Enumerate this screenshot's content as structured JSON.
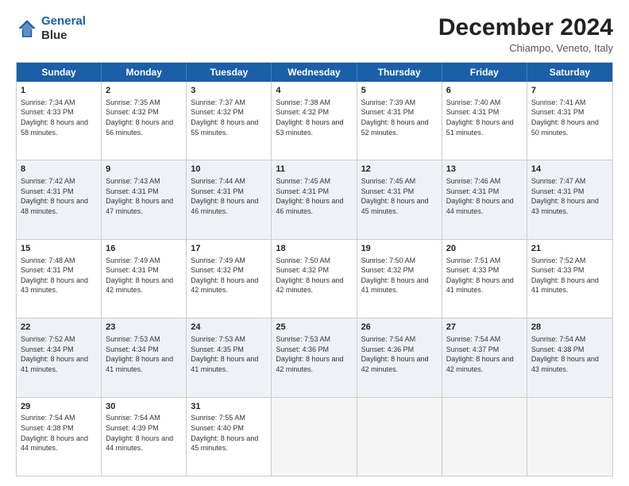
{
  "header": {
    "logo_line1": "General",
    "logo_line2": "Blue",
    "month_title": "December 2024",
    "location": "Chiampo, Veneto, Italy"
  },
  "weekdays": [
    "Sunday",
    "Monday",
    "Tuesday",
    "Wednesday",
    "Thursday",
    "Friday",
    "Saturday"
  ],
  "weeks": [
    [
      {
        "day": "1",
        "sunrise": "Sunrise: 7:34 AM",
        "sunset": "Sunset: 4:33 PM",
        "daylight": "Daylight: 8 hours and 58 minutes."
      },
      {
        "day": "2",
        "sunrise": "Sunrise: 7:35 AM",
        "sunset": "Sunset: 4:32 PM",
        "daylight": "Daylight: 8 hours and 56 minutes."
      },
      {
        "day": "3",
        "sunrise": "Sunrise: 7:37 AM",
        "sunset": "Sunset: 4:32 PM",
        "daylight": "Daylight: 8 hours and 55 minutes."
      },
      {
        "day": "4",
        "sunrise": "Sunrise: 7:38 AM",
        "sunset": "Sunset: 4:32 PM",
        "daylight": "Daylight: 8 hours and 53 minutes."
      },
      {
        "day": "5",
        "sunrise": "Sunrise: 7:39 AM",
        "sunset": "Sunset: 4:31 PM",
        "daylight": "Daylight: 8 hours and 52 minutes."
      },
      {
        "day": "6",
        "sunrise": "Sunrise: 7:40 AM",
        "sunset": "Sunset: 4:31 PM",
        "daylight": "Daylight: 8 hours and 51 minutes."
      },
      {
        "day": "7",
        "sunrise": "Sunrise: 7:41 AM",
        "sunset": "Sunset: 4:31 PM",
        "daylight": "Daylight: 8 hours and 50 minutes."
      }
    ],
    [
      {
        "day": "8",
        "sunrise": "Sunrise: 7:42 AM",
        "sunset": "Sunset: 4:31 PM",
        "daylight": "Daylight: 8 hours and 48 minutes."
      },
      {
        "day": "9",
        "sunrise": "Sunrise: 7:43 AM",
        "sunset": "Sunset: 4:31 PM",
        "daylight": "Daylight: 8 hours and 47 minutes."
      },
      {
        "day": "10",
        "sunrise": "Sunrise: 7:44 AM",
        "sunset": "Sunset: 4:31 PM",
        "daylight": "Daylight: 8 hours and 46 minutes."
      },
      {
        "day": "11",
        "sunrise": "Sunrise: 7:45 AM",
        "sunset": "Sunset: 4:31 PM",
        "daylight": "Daylight: 8 hours and 46 minutes."
      },
      {
        "day": "12",
        "sunrise": "Sunrise: 7:45 AM",
        "sunset": "Sunset: 4:31 PM",
        "daylight": "Daylight: 8 hours and 45 minutes."
      },
      {
        "day": "13",
        "sunrise": "Sunrise: 7:46 AM",
        "sunset": "Sunset: 4:31 PM",
        "daylight": "Daylight: 8 hours and 44 minutes."
      },
      {
        "day": "14",
        "sunrise": "Sunrise: 7:47 AM",
        "sunset": "Sunset: 4:31 PM",
        "daylight": "Daylight: 8 hours and 43 minutes."
      }
    ],
    [
      {
        "day": "15",
        "sunrise": "Sunrise: 7:48 AM",
        "sunset": "Sunset: 4:31 PM",
        "daylight": "Daylight: 8 hours and 43 minutes."
      },
      {
        "day": "16",
        "sunrise": "Sunrise: 7:49 AM",
        "sunset": "Sunset: 4:31 PM",
        "daylight": "Daylight: 8 hours and 42 minutes."
      },
      {
        "day": "17",
        "sunrise": "Sunrise: 7:49 AM",
        "sunset": "Sunset: 4:32 PM",
        "daylight": "Daylight: 8 hours and 42 minutes."
      },
      {
        "day": "18",
        "sunrise": "Sunrise: 7:50 AM",
        "sunset": "Sunset: 4:32 PM",
        "daylight": "Daylight: 8 hours and 42 minutes."
      },
      {
        "day": "19",
        "sunrise": "Sunrise: 7:50 AM",
        "sunset": "Sunset: 4:32 PM",
        "daylight": "Daylight: 8 hours and 41 minutes."
      },
      {
        "day": "20",
        "sunrise": "Sunrise: 7:51 AM",
        "sunset": "Sunset: 4:33 PM",
        "daylight": "Daylight: 8 hours and 41 minutes."
      },
      {
        "day": "21",
        "sunrise": "Sunrise: 7:52 AM",
        "sunset": "Sunset: 4:33 PM",
        "daylight": "Daylight: 8 hours and 41 minutes."
      }
    ],
    [
      {
        "day": "22",
        "sunrise": "Sunrise: 7:52 AM",
        "sunset": "Sunset: 4:34 PM",
        "daylight": "Daylight: 8 hours and 41 minutes."
      },
      {
        "day": "23",
        "sunrise": "Sunrise: 7:53 AM",
        "sunset": "Sunset: 4:34 PM",
        "daylight": "Daylight: 8 hours and 41 minutes."
      },
      {
        "day": "24",
        "sunrise": "Sunrise: 7:53 AM",
        "sunset": "Sunset: 4:35 PM",
        "daylight": "Daylight: 8 hours and 41 minutes."
      },
      {
        "day": "25",
        "sunrise": "Sunrise: 7:53 AM",
        "sunset": "Sunset: 4:36 PM",
        "daylight": "Daylight: 8 hours and 42 minutes."
      },
      {
        "day": "26",
        "sunrise": "Sunrise: 7:54 AM",
        "sunset": "Sunset: 4:36 PM",
        "daylight": "Daylight: 8 hours and 42 minutes."
      },
      {
        "day": "27",
        "sunrise": "Sunrise: 7:54 AM",
        "sunset": "Sunset: 4:37 PM",
        "daylight": "Daylight: 8 hours and 42 minutes."
      },
      {
        "day": "28",
        "sunrise": "Sunrise: 7:54 AM",
        "sunset": "Sunset: 4:38 PM",
        "daylight": "Daylight: 8 hours and 43 minutes."
      }
    ],
    [
      {
        "day": "29",
        "sunrise": "Sunrise: 7:54 AM",
        "sunset": "Sunset: 4:38 PM",
        "daylight": "Daylight: 8 hours and 44 minutes."
      },
      {
        "day": "30",
        "sunrise": "Sunrise: 7:54 AM",
        "sunset": "Sunset: 4:39 PM",
        "daylight": "Daylight: 8 hours and 44 minutes."
      },
      {
        "day": "31",
        "sunrise": "Sunrise: 7:55 AM",
        "sunset": "Sunset: 4:40 PM",
        "daylight": "Daylight: 8 hours and 45 minutes."
      },
      null,
      null,
      null,
      null
    ]
  ]
}
